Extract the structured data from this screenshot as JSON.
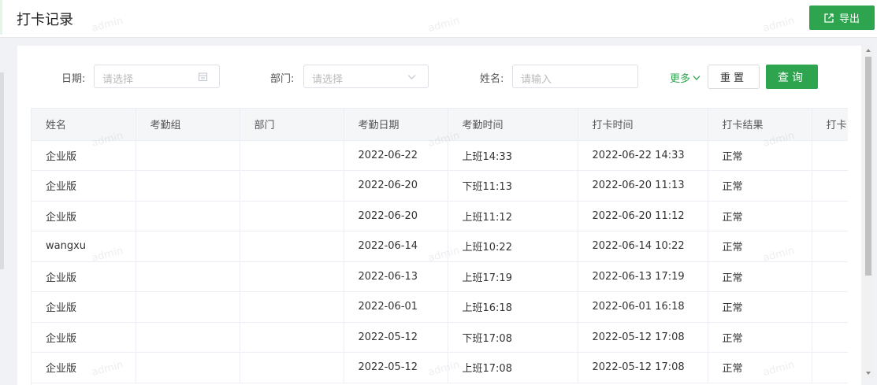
{
  "header": {
    "title": "打卡记录",
    "export_label": "导出"
  },
  "filters": {
    "date_label": "日期:",
    "date_placeholder": "请选择",
    "dept_label": "部门:",
    "dept_placeholder": "请选择",
    "name_label": "姓名:",
    "name_placeholder": "请输入",
    "more_label": "更多",
    "reset_label": "重置",
    "query_label": "查询"
  },
  "table": {
    "columns": [
      "姓名",
      "考勤组",
      "部门",
      "考勤日期",
      "考勤时间",
      "打卡时间",
      "打卡结果",
      "打卡"
    ],
    "rows": [
      {
        "name": "企业版",
        "group": "",
        "dept": "",
        "date": "2022-06-22",
        "time": "上班14:33",
        "punch": "2022-06-22 14:33",
        "result": "正常",
        "extra": ""
      },
      {
        "name": "企业版",
        "group": "",
        "dept": "",
        "date": "2022-06-20",
        "time": "下班11:13",
        "punch": "2022-06-20 11:13",
        "result": "正常",
        "extra": ""
      },
      {
        "name": "企业版",
        "group": "",
        "dept": "",
        "date": "2022-06-20",
        "time": "上班11:12",
        "punch": "2022-06-20 11:12",
        "result": "正常",
        "extra": ""
      },
      {
        "name": "wangxu",
        "group": "",
        "dept": "",
        "date": "2022-06-14",
        "time": "上班10:22",
        "punch": "2022-06-14 10:22",
        "result": "正常",
        "extra": ""
      },
      {
        "name": "企业版",
        "group": "",
        "dept": "",
        "date": "2022-06-13",
        "time": "上班17:19",
        "punch": "2022-06-13 17:19",
        "result": "正常",
        "extra": ""
      },
      {
        "name": "企业版",
        "group": "",
        "dept": "",
        "date": "2022-06-01",
        "time": "上班16:18",
        "punch": "2022-06-01 16:18",
        "result": "正常",
        "extra": ""
      },
      {
        "name": "企业版",
        "group": "",
        "dept": "",
        "date": "2022-05-12",
        "time": "下班17:08",
        "punch": "2022-05-12 17:08",
        "result": "正常",
        "extra": ""
      },
      {
        "name": "企业版",
        "group": "",
        "dept": "",
        "date": "2022-05-12",
        "time": "上班17:08",
        "punch": "2022-05-12 17:08",
        "result": "正常",
        "extra": ""
      }
    ]
  },
  "watermark": "admin",
  "colors": {
    "accent": "#2ea44f"
  },
  "icons": {
    "export": "export-icon",
    "calendar": "calendar-icon",
    "dropdown": "chevron-down-icon",
    "more": "chevron-down-icon"
  }
}
